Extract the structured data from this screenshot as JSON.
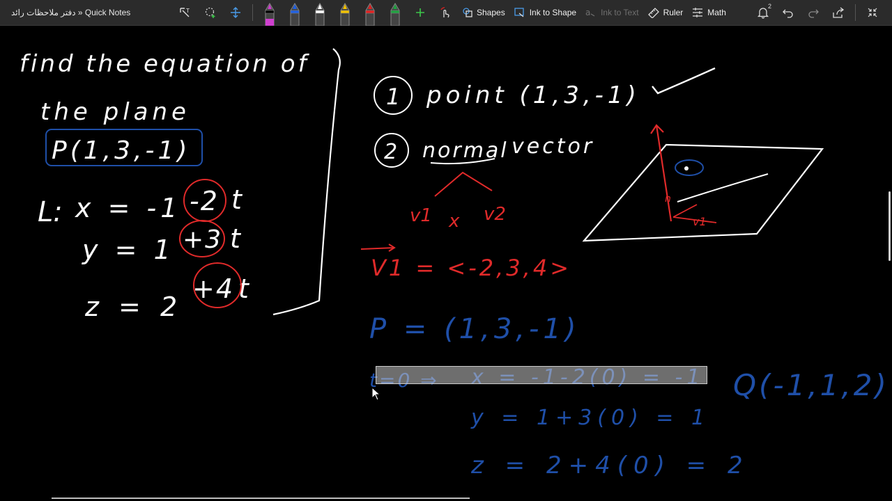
{
  "window": {
    "title": "دفتر ملاحظات رائد » Quick Notes"
  },
  "toolbar": {
    "shapes_label": "Shapes",
    "ink_to_shape_label": "Ink to Shape",
    "ink_to_text_label": "Ink to Text",
    "ruler_label": "Ruler",
    "math_label": "Math",
    "notification_count": "2",
    "pens": [
      {
        "name": "pen-black-pink",
        "color": "#000000",
        "accent": "#d040d0"
      },
      {
        "name": "pen-blue",
        "color": "#2060e0",
        "accent": "#2060e0"
      },
      {
        "name": "pen-white",
        "color": "#ffffff",
        "accent": "#ffffff"
      },
      {
        "name": "pen-yellow",
        "color": "#f0c000",
        "accent": "#f0c000"
      },
      {
        "name": "pen-red",
        "color": "#e02020",
        "accent": "#e02020"
      },
      {
        "name": "pen-green",
        "color": "#20a040",
        "accent": "#20a040"
      }
    ]
  },
  "colors": {
    "ink_white": "#ffffff",
    "ink_red": "#e02a2a",
    "ink_blue": "#1f4fa8",
    "accent_green": "#3cc84a"
  },
  "notes": {
    "left": {
      "line1": "find the equation of",
      "line2": "the plane",
      "point": "P(1,3,-1)",
      "line_label": "L:",
      "x_eq": "x = -1",
      "x_coef": "-2",
      "y_eq": "y = 1",
      "y_coef": "+3",
      "z_eq": "z = 2",
      "z_coef": "+4",
      "t": "t"
    },
    "right": {
      "step1_num": "1",
      "step1": "point (1,3,-1)",
      "step2_num": "2",
      "step2_a": "normal",
      "step2_b": "vector",
      "v1": "v1",
      "x": "x",
      "v2": "v2",
      "v1_def": "V1 = <-2,3,4>",
      "p_def": "P = (1,3,-1)",
      "t0": "t=0 ⇒",
      "x_calc": "x = -1-2(0) = -1",
      "y_calc": "y = 1+3(0) = 1",
      "z_calc": "z = 2+4(0) = 2",
      "q_point": "Q(-1,1,2)",
      "diagram_n": "n",
      "diagram_v1": "v1"
    }
  }
}
